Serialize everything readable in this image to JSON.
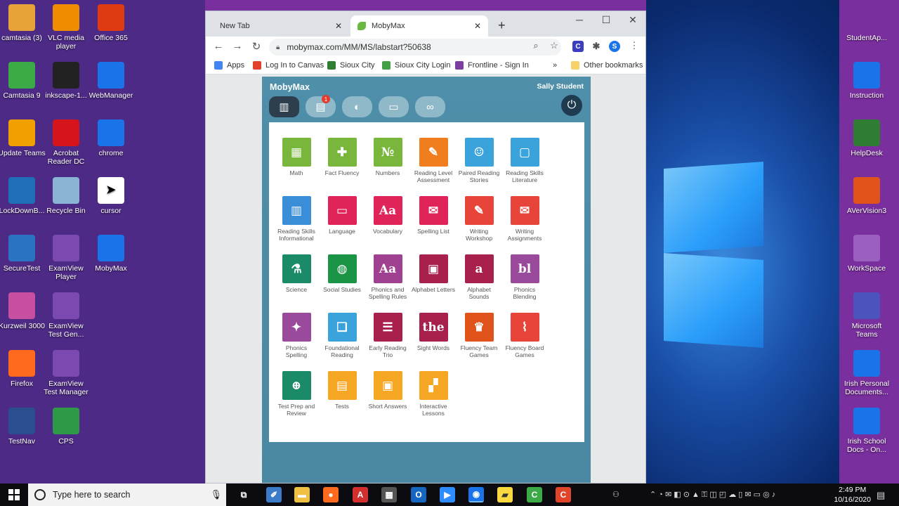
{
  "desktop": {
    "left_icons": [
      {
        "label": "camtasia (3)",
        "icon": "folder-icon",
        "color": "#e8a23a"
      },
      {
        "label": "Camtasia 9",
        "icon": "camtasia-icon",
        "color": "#3daa48"
      },
      {
        "label": "Update Teams",
        "icon": "cloud-icon",
        "color": "#f0a000"
      },
      {
        "label": "LockDownB...",
        "icon": "lockdown-icon",
        "color": "#1e6fb8"
      },
      {
        "label": "SecureTest",
        "icon": "securetest-icon",
        "color": "#2a72c2"
      },
      {
        "label": "Kurzweil 3000",
        "icon": "kurzweil-icon",
        "color": "#c84fa0"
      },
      {
        "label": "Firefox",
        "icon": "firefox-icon",
        "color": "#ff6a1f"
      },
      {
        "label": "TestNav",
        "icon": "testnav-icon",
        "color": "#2b4f8e"
      }
    ],
    "mid_icons_col1": [
      {
        "label": "VLC media player",
        "icon": "vlc-icon",
        "color": "#f08c00"
      },
      {
        "label": "inkscape-1...",
        "icon": "inkscape-icon",
        "color": "#222222"
      },
      {
        "label": "Acrobat Reader DC",
        "icon": "acrobat-icon",
        "color": "#d5141c"
      },
      {
        "label": "Recycle Bin",
        "icon": "recycle-bin-icon",
        "color": "#8ab4d6"
      },
      {
        "label": "ExamView Player",
        "icon": "examview-icon",
        "color": "#7a4ab0"
      },
      {
        "label": "ExamView Test Gen...",
        "icon": "examview-icon",
        "color": "#7a4ab0"
      },
      {
        "label": "ExamView Test Manager",
        "icon": "examview-icon",
        "color": "#7a4ab0"
      },
      {
        "label": "CPS",
        "icon": "cps-icon",
        "color": "#2e9a48"
      }
    ],
    "mid_icons_col2": [
      {
        "label": "Office 365",
        "icon": "office-icon",
        "color": "#e03a12"
      },
      {
        "label": "WebManager",
        "icon": "chrome-icon",
        "color": "#1a73e8"
      },
      {
        "label": "chrome",
        "icon": "chrome-icon",
        "color": "#1a73e8"
      },
      {
        "label": "cursor",
        "icon": "cursor-icon",
        "color": "#ffffff"
      },
      {
        "label": "MobyMax",
        "icon": "chrome-icon",
        "color": "#1a73e8"
      }
    ],
    "right_icons": [
      {
        "label": "StudentAp...",
        "icon": "student-app-icon",
        "color": "#7a2f9f"
      },
      {
        "label": "Instruction",
        "icon": "chat-icon",
        "color": "#1a73e8"
      },
      {
        "label": "HelpDesk",
        "icon": "helpdesk-icon",
        "color": "#2e7d32"
      },
      {
        "label": "AVerVision3",
        "icon": "aver-icon",
        "color": "#e0541c"
      },
      {
        "label": "WorkSpace",
        "icon": "workspace-icon",
        "color": "#9b5fc0"
      },
      {
        "label": "Microsoft Teams",
        "icon": "teams-icon",
        "color": "#4b53bc"
      },
      {
        "label": "Irish Personal Documents...",
        "icon": "chrome-icon",
        "color": "#1a73e8"
      },
      {
        "label": "Irish School Docs - On...",
        "icon": "chrome-icon",
        "color": "#1a73e8"
      }
    ]
  },
  "browser": {
    "tabs": [
      {
        "label": "New Tab",
        "active": false
      },
      {
        "label": "MobyMax",
        "active": true
      }
    ],
    "url": "mobymax.com/MM/MS/labstart?50638",
    "bookmarks": [
      {
        "label": "Apps",
        "color": "#4285f4"
      },
      {
        "label": "Log In to Canvas",
        "color": "#e2412b"
      },
      {
        "label": "Sioux City",
        "color": "#2e7d32"
      },
      {
        "label": "Sioux City Login",
        "color": "#43a047"
      },
      {
        "label": "Frontline - Sign In",
        "color": "#7b3fa0"
      }
    ],
    "more_bookmarks": "»",
    "other_bookmarks": "Other bookmarks",
    "profile_initial": "S"
  },
  "mobymax": {
    "title": "MobyMax",
    "user": "Sally Student",
    "nav": [
      {
        "name": "library-icon",
        "glyph": "▥",
        "active": true
      },
      {
        "name": "assignments-icon",
        "glyph": "▤",
        "badge": "1"
      },
      {
        "name": "badges-icon",
        "glyph": "◐"
      },
      {
        "name": "messages-icon",
        "glyph": "▭"
      },
      {
        "name": "games-icon",
        "glyph": "∞"
      }
    ],
    "power_glyph": "⏻",
    "subjects": [
      {
        "label": "Math",
        "color": "#79b63c",
        "glyph": "▦"
      },
      {
        "label": "Fact Fluency",
        "color": "#79b63c",
        "glyph": "✚"
      },
      {
        "label": "Numbers",
        "color": "#79b63c",
        "glyph": "№"
      },
      {
        "label": "Reading Level Assessment",
        "color": "#f07d1e",
        "glyph": "✎"
      },
      {
        "label": "Paired Reading Stories",
        "color": "#3aa3dc",
        "glyph": "☺"
      },
      {
        "label": "Reading Skills Literature",
        "color": "#3aa3dc",
        "glyph": "▢"
      },
      {
        "label": "Reading Skills Informational",
        "color": "#3a8ed8",
        "glyph": "▥"
      },
      {
        "label": "Language",
        "color": "#e0245a",
        "glyph": "▭"
      },
      {
        "label": "Vocabulary",
        "color": "#e0245a",
        "glyph": "Aa"
      },
      {
        "label": "Spelling List",
        "color": "#e0245a",
        "glyph": "✉"
      },
      {
        "label": "Writing Workshop",
        "color": "#e8453a",
        "glyph": "✎"
      },
      {
        "label": "Writing Assignments",
        "color": "#e8453a",
        "glyph": "✉"
      },
      {
        "label": "Science",
        "color": "#1b8a68",
        "glyph": "⚗"
      },
      {
        "label": "Social Studies",
        "color": "#1b9446",
        "glyph": "◍"
      },
      {
        "label": "Phonics and Spelling Rules",
        "color": "#a04090",
        "glyph": "Aa"
      },
      {
        "label": "Alphabet Letters",
        "color": "#a8204c",
        "glyph": "▣"
      },
      {
        "label": "Alphabet Sounds",
        "color": "#a8204c",
        "glyph": "a"
      },
      {
        "label": "Phonics Blending",
        "color": "#9a4a9a",
        "glyph": "bl"
      },
      {
        "label": "Phonics Spelling",
        "color": "#9a4a9a",
        "glyph": "✦"
      },
      {
        "label": "Foundational Reading",
        "color": "#3aa3dc",
        "glyph": "❏"
      },
      {
        "label": "Early Reading Trio",
        "color": "#a8204c",
        "glyph": "☰"
      },
      {
        "label": "Sight Words",
        "color": "#a8204c",
        "glyph": "the"
      },
      {
        "label": "Fluency Team Games",
        "color": "#e0541c",
        "glyph": "♛"
      },
      {
        "label": "Fluency Board Games",
        "color": "#e8453a",
        "glyph": "⌇"
      },
      {
        "label": "Test Prep and Review",
        "color": "#1b8a68",
        "glyph": "⊕"
      },
      {
        "label": "Tests",
        "color": "#f5a623",
        "glyph": "▤"
      },
      {
        "label": "Short Answers",
        "color": "#f5a623",
        "glyph": "▣"
      },
      {
        "label": "Interactive Lessons",
        "color": "#f5a623",
        "glyph": "▞"
      }
    ]
  },
  "taskbar": {
    "search_placeholder": "Type here to search",
    "apps": [
      {
        "name": "task-view-icon",
        "color": "#0b0b10",
        "glyph": "⧉"
      },
      {
        "name": "paint-icon",
        "color": "#3b7bc8",
        "glyph": "✐"
      },
      {
        "name": "file-explorer-icon",
        "color": "#f0c040",
        "glyph": "▬"
      },
      {
        "name": "firefox-icon",
        "color": "#ff6a1f",
        "glyph": "●"
      },
      {
        "name": "angular-icon",
        "color": "#d32f2f",
        "glyph": "A"
      },
      {
        "name": "calculator-icon",
        "color": "#555555",
        "glyph": "▦"
      },
      {
        "name": "outlook-icon",
        "color": "#1466c0",
        "glyph": "O"
      },
      {
        "name": "zoom-icon",
        "color": "#2d8cff",
        "glyph": "▶"
      },
      {
        "name": "chrome-icon",
        "color": "#1a73e8",
        "glyph": "◉"
      },
      {
        "name": "sticky-notes-icon",
        "color": "#f8d940",
        "glyph": "▰"
      },
      {
        "name": "camtasia-icon",
        "color": "#3daa48",
        "glyph": "C"
      },
      {
        "name": "camtasia-recorder-icon",
        "color": "#e0452b",
        "glyph": "C"
      }
    ],
    "time": "2:49 PM",
    "date": "10/16/2020"
  }
}
